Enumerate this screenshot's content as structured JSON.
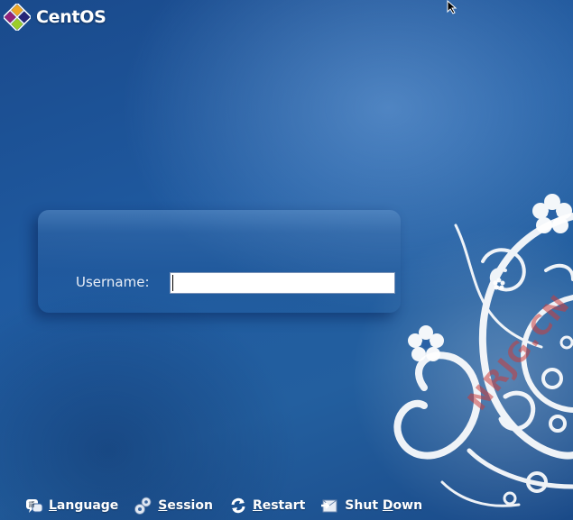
{
  "brand": {
    "name": "CentOS"
  },
  "login": {
    "username_label": "Username:",
    "username_value": ""
  },
  "bottom_bar": {
    "language": {
      "mnemonic": "L",
      "rest": "anguage",
      "icon": "language-icon"
    },
    "session": {
      "mnemonic": "S",
      "rest": "ession",
      "icon": "session-gears-icon"
    },
    "restart": {
      "mnemonic": "R",
      "rest": "estart",
      "icon": "restart-icon"
    },
    "shutdown": {
      "before": "Shut ",
      "mnemonic": "D",
      "rest": "own",
      "icon": "shutdown-icon"
    }
  },
  "watermark": "NRJG.CN",
  "colors": {
    "background": "#1f5aa0",
    "text": "#ffffff",
    "input_bg": "#ffffff"
  }
}
